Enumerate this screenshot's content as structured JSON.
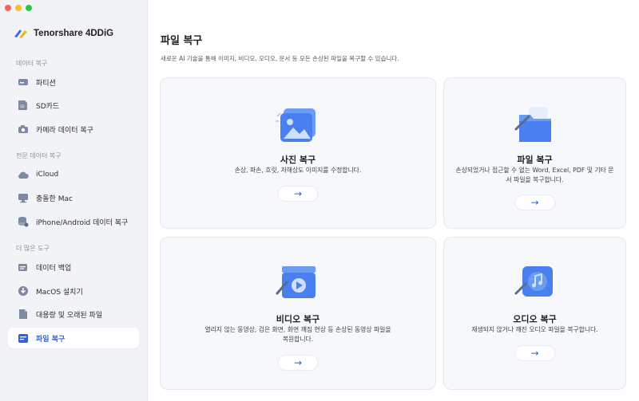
{
  "app": {
    "brand_name": "Tenorshare 4DDiG"
  },
  "colors": {
    "accent": "#2f5fe0",
    "sidebar_bg": "#f2f3f7",
    "card_bg": "#f7f8fc"
  },
  "sidebar": {
    "sections": [
      {
        "label": "데이터 복구"
      },
      {
        "label": "전문 데이터 복구"
      },
      {
        "label": "더 많은 도구"
      }
    ],
    "items": [
      {
        "label": "파티션",
        "icon": "drive-icon"
      },
      {
        "label": "SD카드",
        "icon": "sd-card-icon"
      },
      {
        "label": "카메라 데이터 복구",
        "icon": "camera-icon"
      },
      {
        "label": "iCloud",
        "icon": "cloud-icon"
      },
      {
        "label": "충돌한 Mac",
        "icon": "mac-icon"
      },
      {
        "label": "iPhone/Android 데이터 복구",
        "icon": "phone-icon"
      },
      {
        "label": "데이터 백업",
        "icon": "backup-icon"
      },
      {
        "label": "MacOS 설치기",
        "icon": "installer-icon"
      },
      {
        "label": "대용량 및 오래된 파일",
        "icon": "file-icon"
      },
      {
        "label": "파일 복구",
        "icon": "file-repair-icon",
        "active": true
      }
    ]
  },
  "main": {
    "title": "파일 복구",
    "description": "새로운 AI 기술을 통해 이미지, 비디오, 오디오, 문서 등 모든 손상된 파일을 복구할 수 있습니다.",
    "cards": [
      {
        "title": "사진 복구",
        "desc": "손상, 파손, 흐릿, 저해상도 이미지를 수정합니다.",
        "button": "→",
        "icon": "photo-icon"
      },
      {
        "title": "파일 복구",
        "desc": "손상되었거나 접근할 수 없는 Word, Excel, PDF 및 기타 문서 파일을 복구합니다.",
        "button": "→",
        "icon": "folder-icon"
      },
      {
        "title": "비디오 복구",
        "desc": "열리지 않는 동영상, 검은 화면, 화면 깨짐 현상 등 손상된 동영상 파일을 복원합니다.",
        "button": "→",
        "icon": "video-icon"
      },
      {
        "title": "오디오 복구",
        "desc": "재생되지 않거나 깨진 오디오 파일을 복구합니다.",
        "button": "→",
        "icon": "audio-icon"
      }
    ]
  }
}
